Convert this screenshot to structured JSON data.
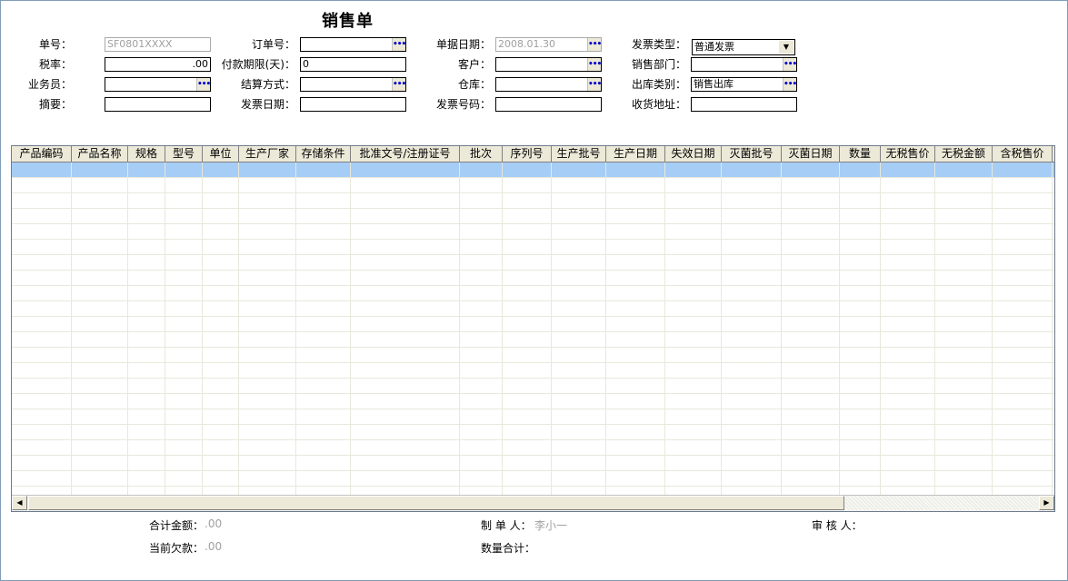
{
  "title": "销售单",
  "form": {
    "order_no": {
      "label": "单号：",
      "value": "SF0801XXXX"
    },
    "po_no": {
      "label": "订单号：",
      "value": ""
    },
    "doc_date": {
      "label": "单据日期：",
      "value": "2008.01.30"
    },
    "invoice_type": {
      "label": "发票类型：",
      "value": "普通发票"
    },
    "tax_rate": {
      "label": "税率：",
      "value": ".00"
    },
    "payment_term": {
      "label": "付款期限(天)：",
      "value": "0"
    },
    "customer": {
      "label": "客户：",
      "value": ""
    },
    "sales_dept": {
      "label": "销售部门：",
      "value": ""
    },
    "salesman": {
      "label": "业务员：",
      "value": ""
    },
    "settlement": {
      "label": "结算方式：",
      "value": ""
    },
    "warehouse": {
      "label": "仓库：",
      "value": ""
    },
    "outbound_type": {
      "label": "出库类别：",
      "value": "销售出库"
    },
    "summary": {
      "label": "摘要：",
      "value": ""
    },
    "invoice_date": {
      "label": "发票日期：",
      "value": ""
    },
    "invoice_no": {
      "label": "发票号码：",
      "value": ""
    },
    "ship_address": {
      "label": "收货地址：",
      "value": ""
    }
  },
  "grid": {
    "columns": [
      "产品编码",
      "产品名称",
      "规格",
      "型号",
      "单位",
      "生产厂家",
      "存储条件",
      "批准文号/注册证号",
      "批次",
      "序列号",
      "生产批号",
      "生产日期",
      "失效日期",
      "灭菌批号",
      "灭菌日期",
      "数量",
      "无税售价",
      "无税金额",
      "含税售价"
    ],
    "row_count": 22,
    "selected_row": 0
  },
  "footer": {
    "total_amount": {
      "label": "合计金额：",
      "value": ".00"
    },
    "current_debt": {
      "label": "当前欠款：",
      "value": ".00"
    },
    "maker": {
      "label": "制 单 人：",
      "value": "李小一"
    },
    "qty_total": {
      "label": "数量合计：",
      "value": ""
    },
    "auditor": {
      "label": "审 核 人：",
      "value": ""
    }
  },
  "icons": {
    "lookup": "ellipsis-lookup-icon",
    "dropdown": "chevron-down-icon",
    "scroll_left": "arrow-left-icon",
    "scroll_right": "arrow-right-icon"
  }
}
